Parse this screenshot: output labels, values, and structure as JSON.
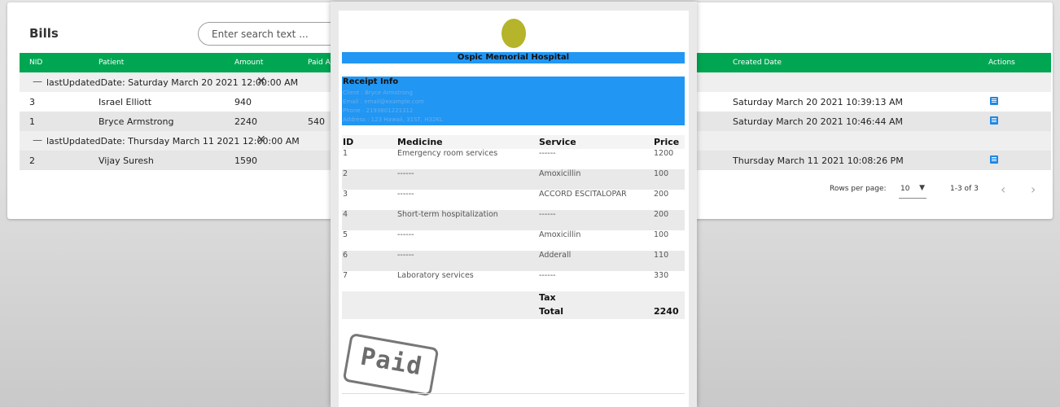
{
  "bills": {
    "title": "Bills",
    "search_placeholder": "Enter search text ...",
    "columns": {
      "nid": "NID",
      "patient": "Patient",
      "amount": "Amount",
      "paid_amount": "Paid Amo",
      "created_date": "Created Date",
      "actions": "Actions"
    },
    "groups": [
      {
        "label": "lastUpdatedDate: Saturday March 20 2021 12:00:00 AM",
        "rows": [
          {
            "nid": "3",
            "patient": "Israel Elliott",
            "amount": "940",
            "paid": "",
            "created": "Saturday March 20 2021 10:39:13 AM"
          },
          {
            "nid": "1",
            "patient": "Bryce Armstrong",
            "amount": "2240",
            "paid": "540",
            "created": "Saturday March 20 2021 10:46:44 AM"
          }
        ]
      },
      {
        "label": "lastUpdatedDate: Thursday March 11 2021 12:00:00 AM",
        "rows": [
          {
            "nid": "2",
            "patient": "Vijay Suresh",
            "amount": "1590",
            "paid": "",
            "created": "Thursday March 11 2021 10:08:26 PM"
          }
        ]
      }
    ],
    "pagination": {
      "rows_per_page_label": "Rows per page:",
      "rows_per_page_value": "10",
      "range": "1-3 of 3"
    }
  },
  "receipt": {
    "hospital": "Ospic Memorial Hospital",
    "info_title": "Receipt Info",
    "client": "Client : Bryce Armstrong",
    "email": "Email : email@example.com",
    "phone": "Phone : 2193801221312",
    "address": "Address : 123 Hawaii, 31ST, H32KL",
    "columns": {
      "id": "ID",
      "medicine": "Medicine",
      "service": "Service",
      "price": "Price"
    },
    "items": [
      {
        "id": "1",
        "medicine": "Emergency room services",
        "service": "------",
        "price": "1200"
      },
      {
        "id": "2",
        "medicine": "------",
        "service": "Amoxicillin",
        "price": "100"
      },
      {
        "id": "3",
        "medicine": "------",
        "service": "ACCORD ESCITALOPAR",
        "price": "200"
      },
      {
        "id": "4",
        "medicine": "Short-term hospitalization",
        "service": "------",
        "price": "200"
      },
      {
        "id": "5",
        "medicine": "------",
        "service": "Amoxicillin",
        "price": "100"
      },
      {
        "id": "6",
        "medicine": "------",
        "service": "Adderall",
        "price": "110"
      },
      {
        "id": "7",
        "medicine": "Laboratory services",
        "service": "------",
        "price": "330"
      }
    ],
    "tax_label": "Tax",
    "total_label": "Total",
    "total_value": "2240",
    "stamp": "Paid",
    "colors": {
      "header_bar": "#2196f3",
      "logo": "#b5b42a"
    }
  },
  "colors": {
    "table_header": "#00a651",
    "action_icon": "#1e88e5"
  }
}
